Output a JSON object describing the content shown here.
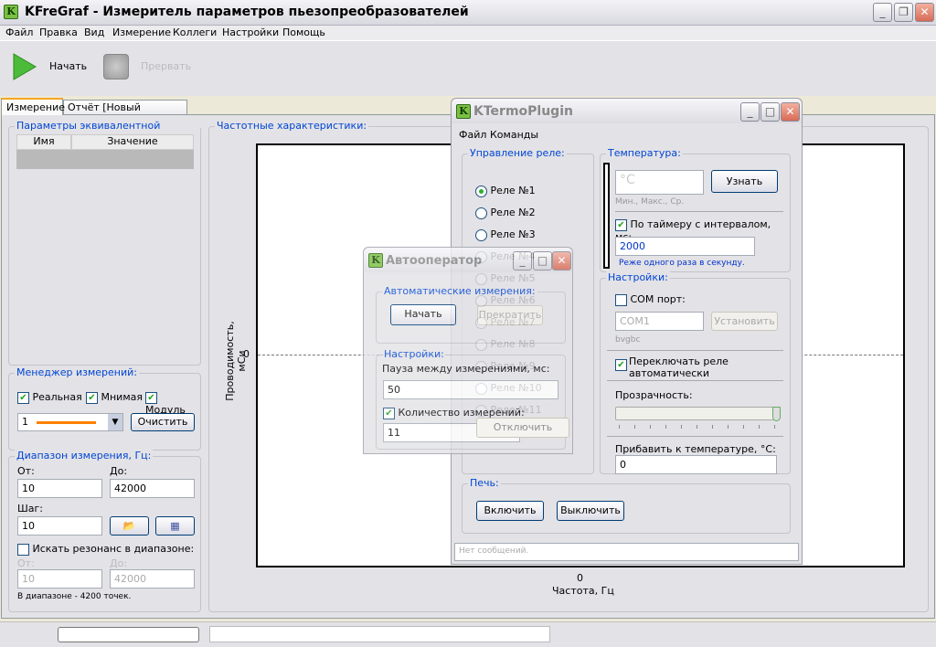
{
  "app": {
    "title": "KFreGraf - Измеритель параметров пьезопреобразователей",
    "icon": "K"
  },
  "menu": [
    "Файл",
    "Правка",
    "Вид",
    "Измерение",
    "Коллеги",
    "Настройки",
    "Помощь"
  ],
  "toolbar": {
    "start": "Начать",
    "abort": "Прервать"
  },
  "tabs": [
    "Измерение",
    "Отчёт [Новый отчёт.txt]"
  ],
  "params": {
    "title": "Параметры эквивалентной схемы:",
    "col_name": "Имя",
    "col_value": "Значение"
  },
  "manager": {
    "title": "Менеджер измерений:",
    "real": "Реальная",
    "imag": "Мнимая",
    "modulus": "Модуль",
    "series": "1",
    "series_color": "#ff8000",
    "clear": "Очистить"
  },
  "range": {
    "title": "Диапазон измерения, Гц:",
    "from_label": "От:",
    "to_label": "До:",
    "from": "10",
    "to": "42000",
    "step_label": "Шаг:",
    "step": "10",
    "resonance": "Искать резонанс в диапазоне:",
    "res_from_label": "От:",
    "res_to_label": "До:",
    "res_from": "10",
    "res_to": "42000",
    "points": "В диапазоне - 4200 точек."
  },
  "chart": {
    "title": "Частотные характеристики:",
    "ylabel": "Проводимость, мСи",
    "xlabel": "Частота, Гц",
    "y_tick": "0",
    "x_tick": "0"
  },
  "ktermo": {
    "title": "KTermoPlugin",
    "menu": [
      "Файл",
      "Команды"
    ],
    "relay_title": "Управление реле:",
    "relays": [
      "Реле №1",
      "Реле №2",
      "Реле №3",
      "Реле №4",
      "Реле №5",
      "Реле №6",
      "Реле №7",
      "Реле №8",
      "Реле №9",
      "Реле №10",
      "Реле №11"
    ],
    "selected_relay": 0,
    "disable": "Отключить",
    "temp_title": "Температура:",
    "temp_placeholder": "°C",
    "query": "Узнать",
    "minmax": "Мин., Макс., Ср.",
    "timer": "По таймеру с интервалом, мс:",
    "interval": "2000",
    "hint": "Реже одного раза в секунду.",
    "settings_title": "Настройки:",
    "com": "COM порт:",
    "com_value": "COM1",
    "set": "Установить",
    "com_note": "bvgbc",
    "auto_switch": "Переключать реле автоматически",
    "opacity": "Прозрачность:",
    "opacity_value": 100,
    "add_temp": "Прибавить к температуре, °C:",
    "add_temp_value": "0",
    "oven_title": "Печь:",
    "on": "Включить",
    "off": "Выключить",
    "messages": "Нет сообщений."
  },
  "auto": {
    "title": "Автооператор",
    "group1": "Автоматические измерения:",
    "start": "Начать",
    "stop": "Прекратить",
    "group2": "Настройки:",
    "pause": "Пауза между измерениями, мс:",
    "pause_value": "50",
    "count": "Количество измерений:",
    "count_value": "11"
  }
}
